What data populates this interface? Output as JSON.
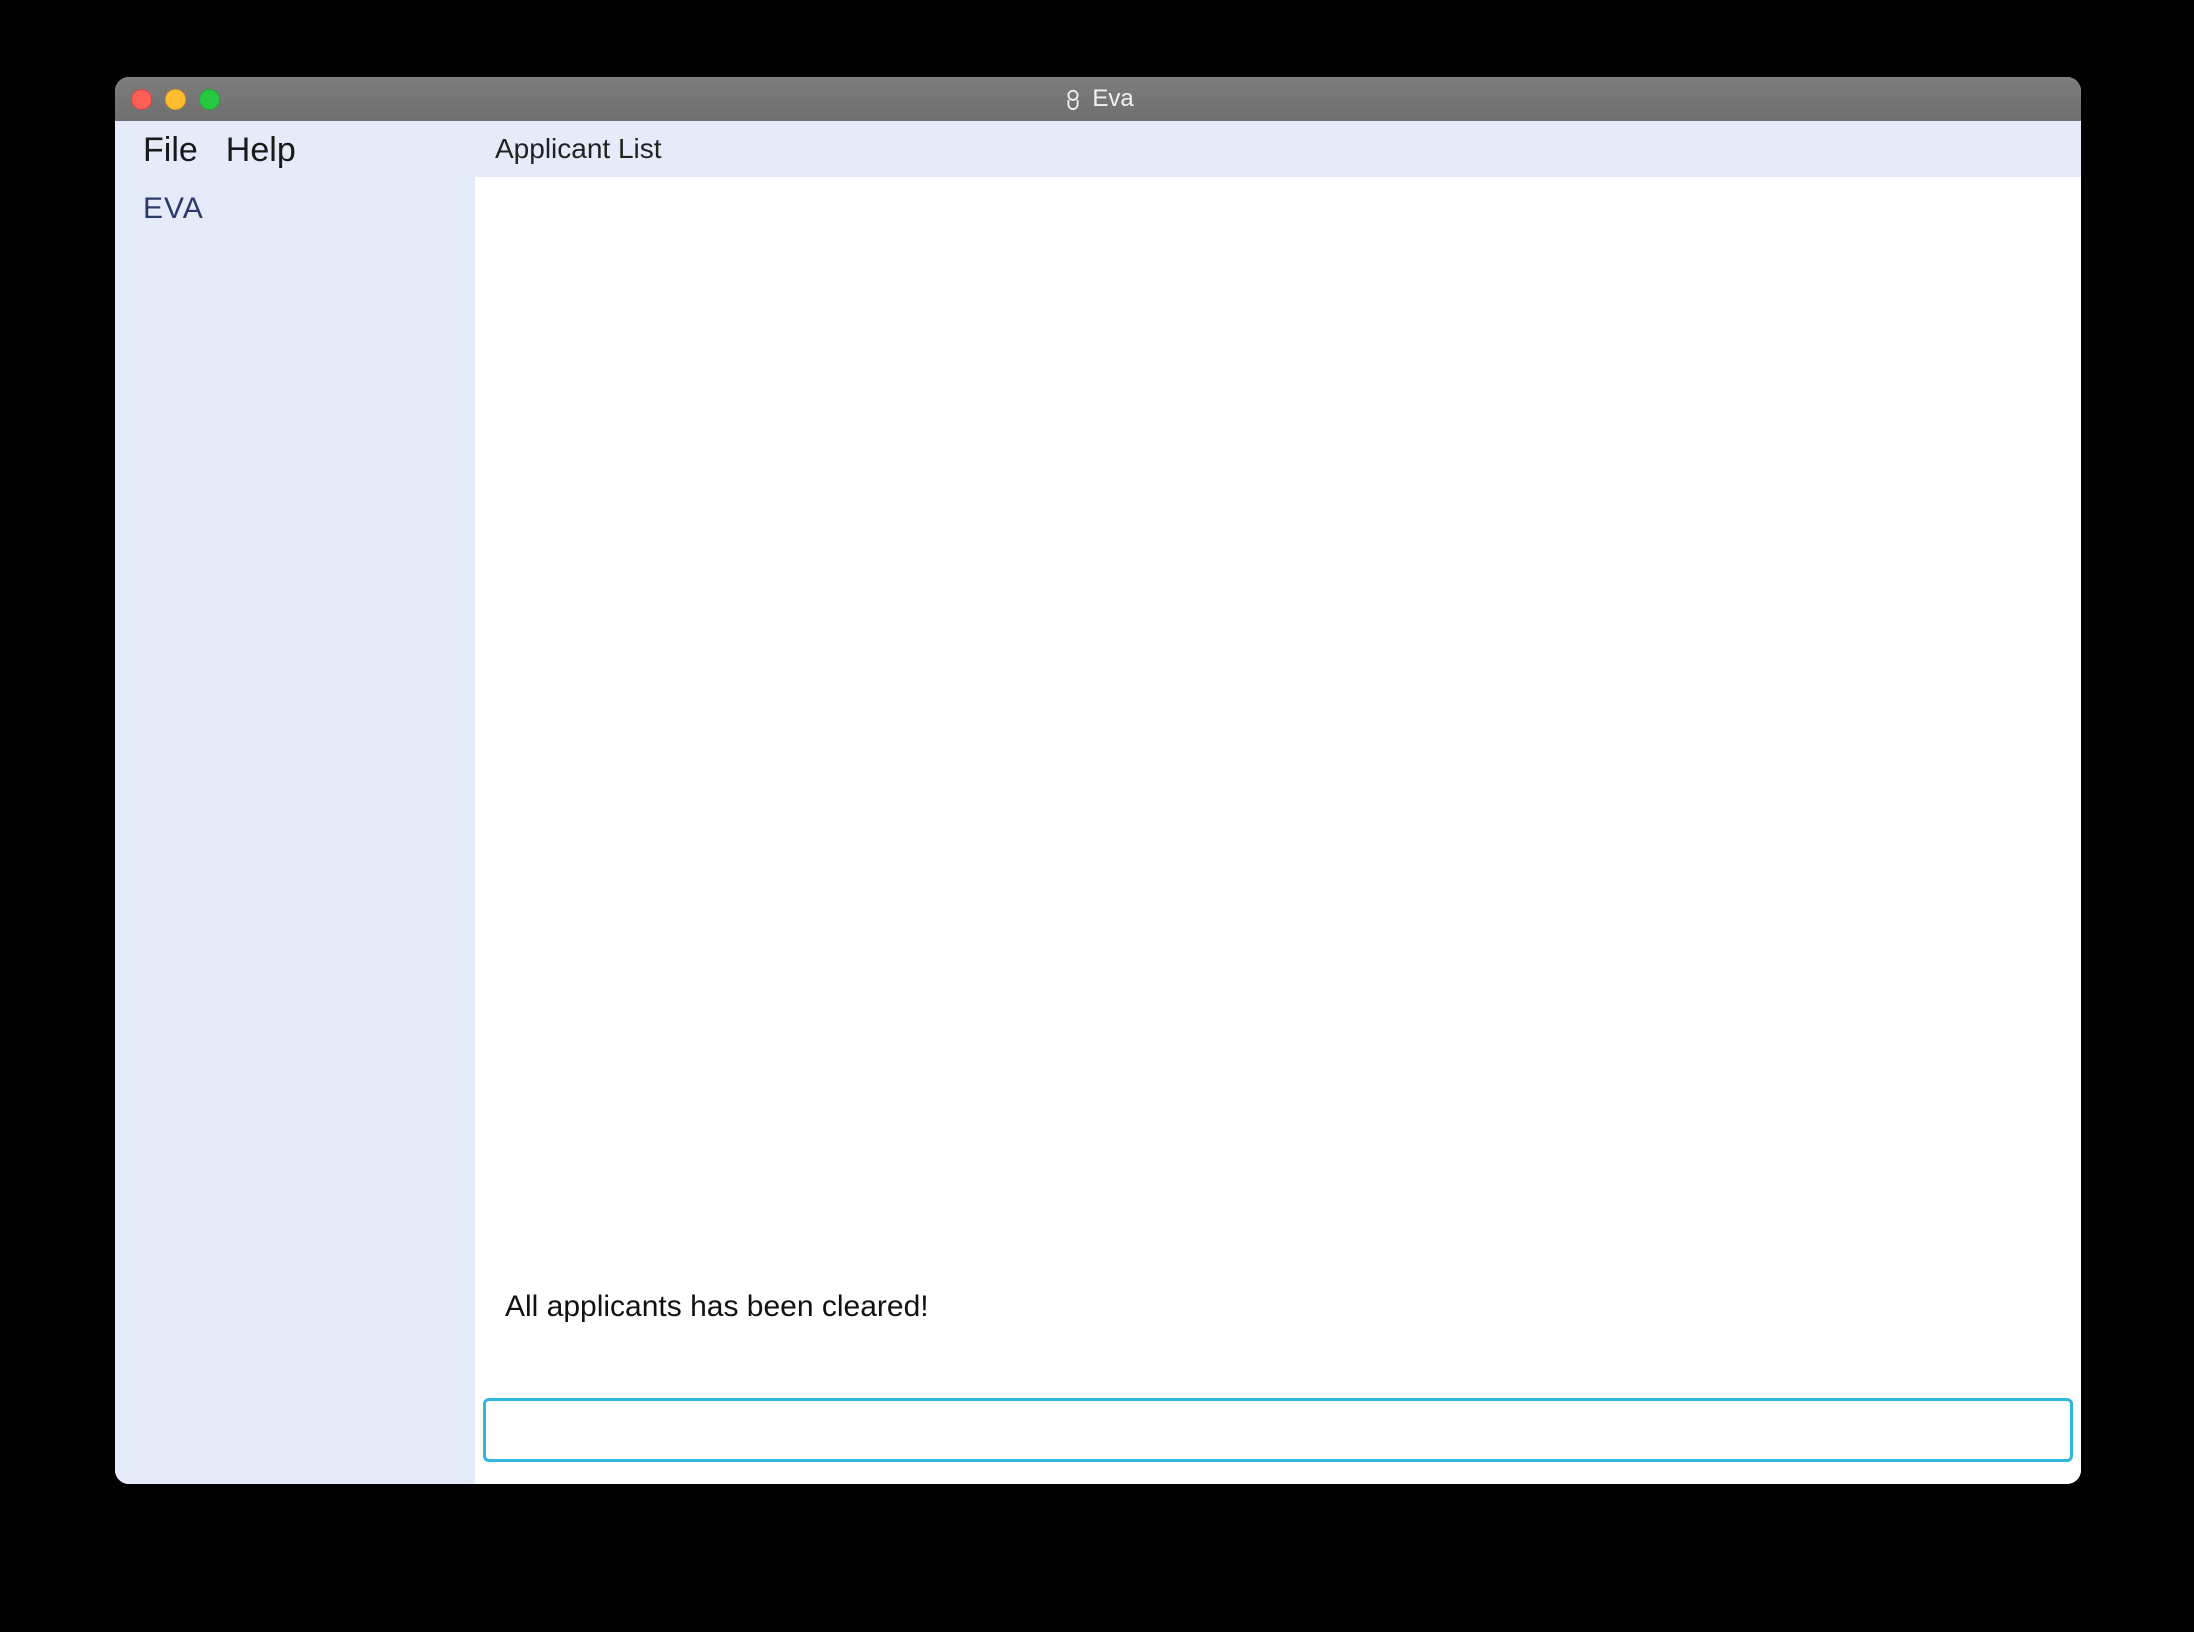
{
  "window": {
    "title": "Eva"
  },
  "menu": {
    "file": "File",
    "help": "Help"
  },
  "sidebar": {
    "brand": "EVA"
  },
  "main": {
    "list_header": "Applicant List",
    "status": "All applicants has been cleared!",
    "command_value": ""
  }
}
